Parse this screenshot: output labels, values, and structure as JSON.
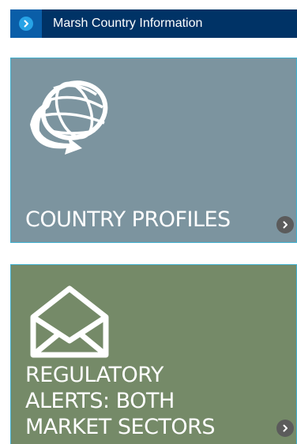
{
  "header": {
    "title": "Marsh Country Information",
    "icon": "chevron-right-circle-icon"
  },
  "tiles": [
    {
      "label": "COUNTRY PROFILES",
      "icon": "globe-icon",
      "background": "#7c949f"
    },
    {
      "label": "REGULATORY\nALERTS: BOTH\nMARKET SECTORS",
      "icon": "envelope-icon",
      "background": "#758a68"
    }
  ],
  "colors": {
    "header_bg": "#003366",
    "header_icon_bg": "#0a5ea8",
    "tile_border": "#3fb0cf"
  }
}
